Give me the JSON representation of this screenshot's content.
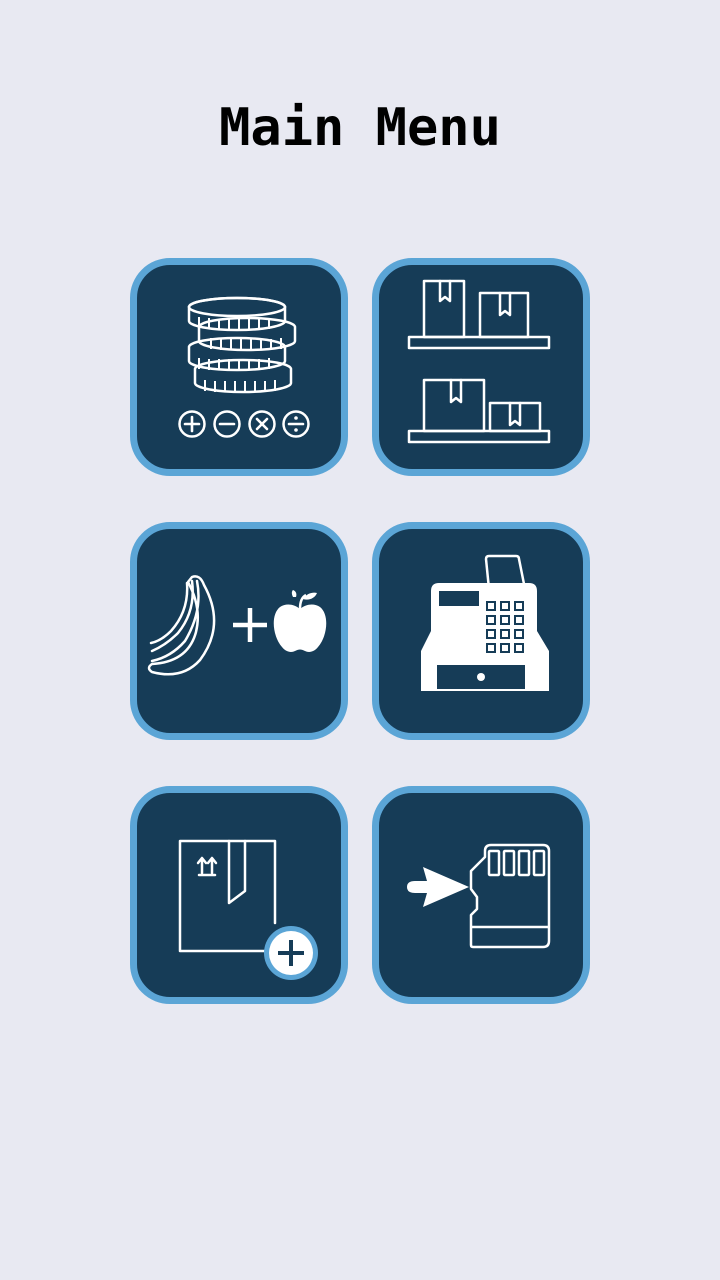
{
  "screen": {
    "title": "Main Menu"
  },
  "colors": {
    "background": "#e8e9f2",
    "tile_fill": "#163c57",
    "tile_border": "#5ba5d6",
    "icon": "#ffffff"
  },
  "menu": {
    "items": [
      {
        "id": "money-calculations",
        "icon": "coins-math-icon"
      },
      {
        "id": "inventory-shelves",
        "icon": "shelves-boxes-icon"
      },
      {
        "id": "add-products",
        "icon": "banana-plus-apple-icon"
      },
      {
        "id": "cash-register",
        "icon": "cash-register-icon"
      },
      {
        "id": "new-package",
        "icon": "box-add-icon"
      },
      {
        "id": "sd-card-import",
        "icon": "sd-card-arrow-icon"
      }
    ]
  }
}
